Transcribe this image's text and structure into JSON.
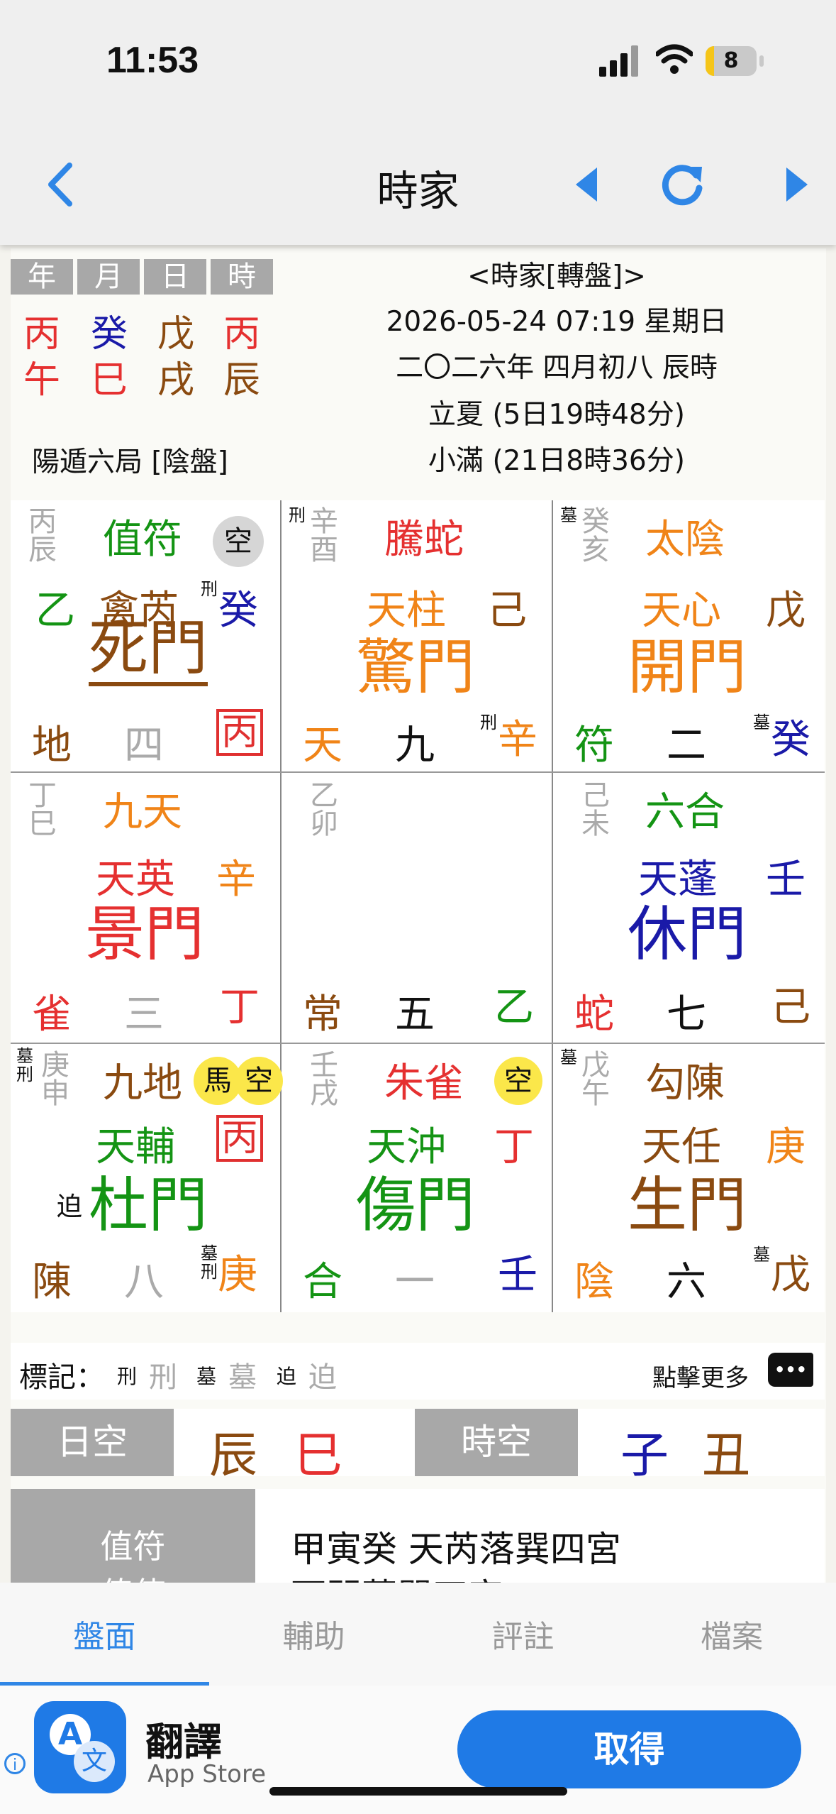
{
  "status_bar": {
    "time": "11:53",
    "battery": "8"
  },
  "nav": {
    "title": "時家"
  },
  "header": {
    "pillars_labels": [
      "年",
      "月",
      "日",
      "時"
    ],
    "stems": [
      "丙",
      "癸",
      "戊",
      "丙"
    ],
    "branches": [
      "午",
      "巳",
      "戌",
      "辰"
    ],
    "ju": "陽遁六局 [陰盤]",
    "title": "<時家[轉盤]>",
    "datetime": "2026-05-24 07:19 星期日",
    "lunar": "二〇二六年 四月初八 辰時",
    "term1": "立夏 (5日19時48分)",
    "term2": "小滿 (21日8時36分)"
  },
  "colors": {
    "red": "#e53030",
    "blue": "#1a1aa8",
    "orange": "#f08418",
    "brown": "#8a4a10",
    "green": "#149414",
    "accent": "#2f86e6"
  },
  "palaces": [
    {
      "hidden": "丙辰",
      "god": "值符",
      "star": "禽芮",
      "star_side": "癸",
      "star_mark": "刑",
      "door": "死門",
      "spirit": "地",
      "number": "四",
      "earth": "丙",
      "badge": "空"
    },
    {
      "hidden": "辛酉",
      "hidden_mark": "刑",
      "god": "騰蛇",
      "star": "天柱",
      "star_side": "己",
      "door": "驚門",
      "spirit": "天",
      "number": "九",
      "earth": "辛",
      "earth_mark": "刑"
    },
    {
      "hidden": "癸亥",
      "hidden_mark": "墓",
      "god": "太陰",
      "star": "天心",
      "star_side": "戊",
      "door": "開門",
      "spirit": "符",
      "number": "二",
      "earth": "癸",
      "earth_mark": "墓"
    },
    {
      "hidden": "丁巳",
      "god": "九天",
      "star": "天英",
      "star_side": "辛",
      "door": "景門",
      "spirit": "雀",
      "number": "三",
      "earth": "丁"
    },
    {
      "hidden": "乙卯",
      "spirit": "常",
      "number": "五",
      "earth": "乙"
    },
    {
      "hidden": "己未",
      "god": "六合",
      "star": "天蓬",
      "star_side": "壬",
      "door": "休門",
      "spirit": "蛇",
      "number": "七",
      "earth": "己"
    },
    {
      "hidden": "庚申",
      "hidden_mark1": "墓",
      "hidden_mark2": "刑",
      "god": "九地",
      "star": "天輔",
      "star_side": "丙",
      "door": "杜門",
      "door_mark": "迫",
      "spirit": "陳",
      "number": "八",
      "earth": "庚",
      "earth_mark1": "墓",
      "earth_mark2": "刑",
      "badge1": "馬",
      "badge2": "空"
    },
    {
      "hidden": "壬戌",
      "god": "朱雀",
      "star": "天沖",
      "star_side": "丁",
      "door": "傷門",
      "spirit": "合",
      "number": "一",
      "earth": "壬",
      "badge": "空"
    },
    {
      "hidden": "戊午",
      "hidden_mark": "墓",
      "god": "勾陳",
      "star": "天任",
      "star_side": "庚",
      "door": "生門",
      "spirit": "陰",
      "number": "六",
      "earth": "戊",
      "earth_mark": "墓"
    }
  ],
  "marks": {
    "label": "標記：",
    "xing_s": "刑",
    "xing": "刑",
    "mu_s": "墓",
    "mu": "墓",
    "po_s": "迫",
    "po": "迫",
    "more": "點擊更多",
    "more_icon": "•••"
  },
  "kong": {
    "day_label": "日空",
    "day_val1": "辰",
    "day_val2": "巳",
    "hour_label": "時空",
    "hour_val1": "子",
    "hour_val2": "丑"
  },
  "detail": {
    "label1": "值符",
    "value1": "甲寅癸  天芮落巽四宮",
    "label2": "值使",
    "value2": "死門落巽四宮"
  },
  "tabs": [
    "盤面",
    "輔助",
    "評註",
    "檔案"
  ],
  "ad": {
    "app_name": "翻譯",
    "store": "App Store",
    "get": "取得",
    "info_icon": "i"
  }
}
